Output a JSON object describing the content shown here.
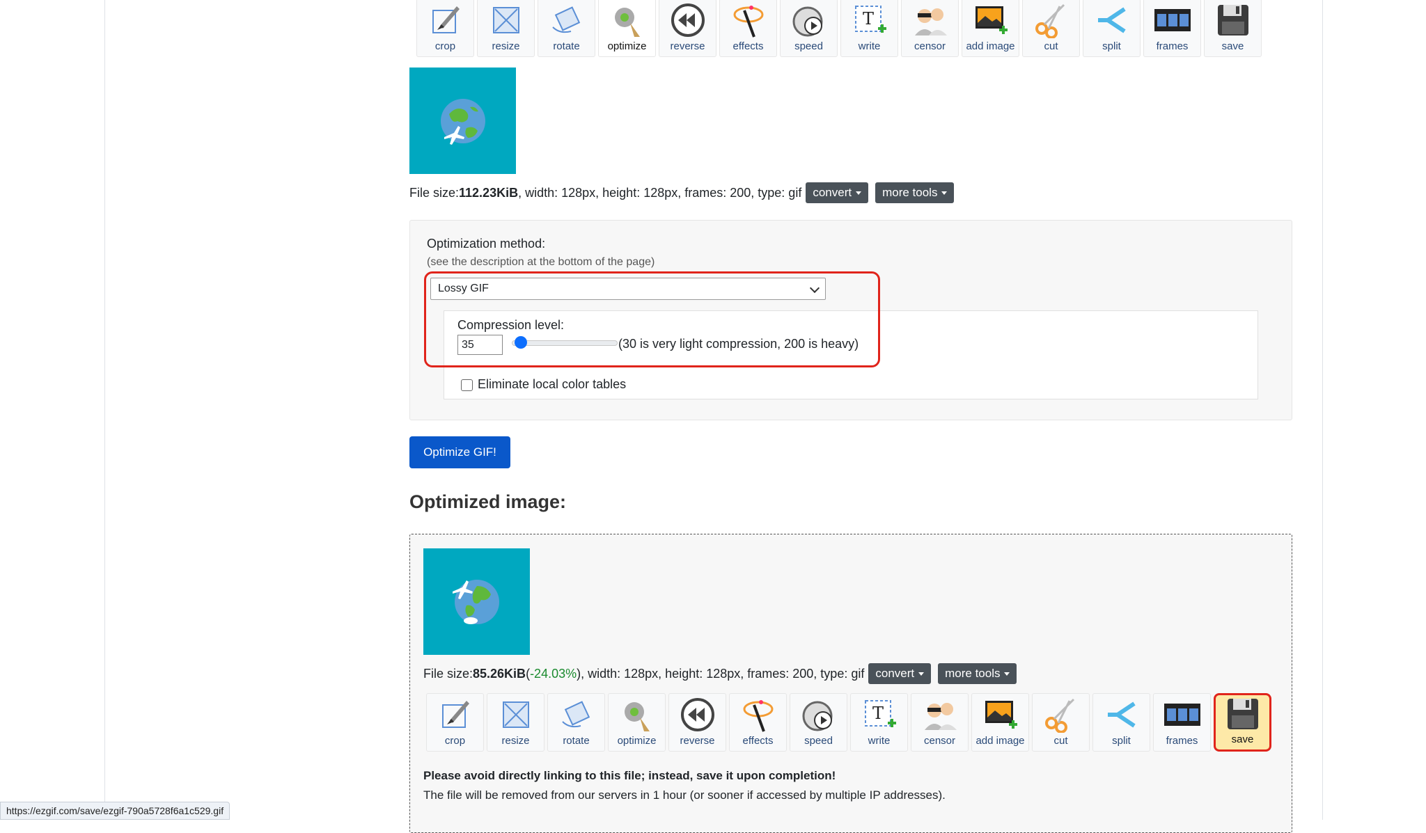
{
  "toolbar_top": {
    "tools": [
      {
        "label": "crop",
        "icon": "crop-icon"
      },
      {
        "label": "resize",
        "icon": "resize-icon"
      },
      {
        "label": "rotate",
        "icon": "rotate-icon"
      },
      {
        "label": "optimize",
        "icon": "optimize-icon",
        "active": true
      },
      {
        "label": "reverse",
        "icon": "reverse-icon"
      },
      {
        "label": "effects",
        "icon": "effects-icon"
      },
      {
        "label": "speed",
        "icon": "speed-icon"
      },
      {
        "label": "write",
        "icon": "write-icon"
      },
      {
        "label": "censor",
        "icon": "censor-icon"
      },
      {
        "label": "add image",
        "icon": "add-image-icon"
      },
      {
        "label": "cut",
        "icon": "cut-icon"
      },
      {
        "label": "split",
        "icon": "split-icon"
      },
      {
        "label": "frames",
        "icon": "frames-icon"
      },
      {
        "label": "save",
        "icon": "save-icon"
      }
    ]
  },
  "original": {
    "file_size_prefix": "File size: ",
    "file_size": "112.23KiB",
    "details": ", width: 128px, height: 128px, frames: 200, type: gif",
    "convert_label": "convert",
    "more_tools_label": "more tools"
  },
  "optimization": {
    "method_label": "Optimization method:",
    "method_hint": "(see the description at the bottom of the page)",
    "selected_method": "Lossy GIF",
    "compression_label": "Compression level:",
    "compression_value": "35",
    "compression_min": 30,
    "compression_max": 200,
    "compression_hint": "(30 is very light compression, 200 is heavy)",
    "eliminate_label": "Eliminate local color tables",
    "submit_label": "Optimize GIF!"
  },
  "result": {
    "heading": "Optimized image:",
    "file_size_prefix": "File size: ",
    "file_size": "85.26KiB",
    "reduction_open": " (",
    "reduction": "-24.03%",
    "details": "), width: 128px, height: 128px, frames: 200, type: gif",
    "convert_label": "convert",
    "more_tools_label": "more tools",
    "notice_bold": "Please avoid directly linking to this file; instead, save it upon completion!",
    "notice_text": "The file will be removed from our servers in 1 hour (or sooner if accessed by multiple IP addresses)."
  },
  "toolbar_bottom": {
    "tools": [
      {
        "label": "crop",
        "icon": "crop-icon"
      },
      {
        "label": "resize",
        "icon": "resize-icon"
      },
      {
        "label": "rotate",
        "icon": "rotate-icon"
      },
      {
        "label": "optimize",
        "icon": "optimize-icon"
      },
      {
        "label": "reverse",
        "icon": "reverse-icon"
      },
      {
        "label": "effects",
        "icon": "effects-icon"
      },
      {
        "label": "speed",
        "icon": "speed-icon"
      },
      {
        "label": "write",
        "icon": "write-icon"
      },
      {
        "label": "censor",
        "icon": "censor-icon"
      },
      {
        "label": "add image",
        "icon": "add-image-icon"
      },
      {
        "label": "cut",
        "icon": "cut-icon"
      },
      {
        "label": "split",
        "icon": "split-icon"
      },
      {
        "label": "frames",
        "icon": "frames-icon"
      },
      {
        "label": "save",
        "icon": "save-icon",
        "highlighted": true
      }
    ]
  },
  "status_url": "https://ezgif.com/save/ezgif-790a5728f6a1c529.gif",
  "colors": {
    "accent": "#0a58ca",
    "highlight": "#e0241b",
    "thumb_bg": "#00a8c0",
    "reduction": "#1a8a2e"
  }
}
